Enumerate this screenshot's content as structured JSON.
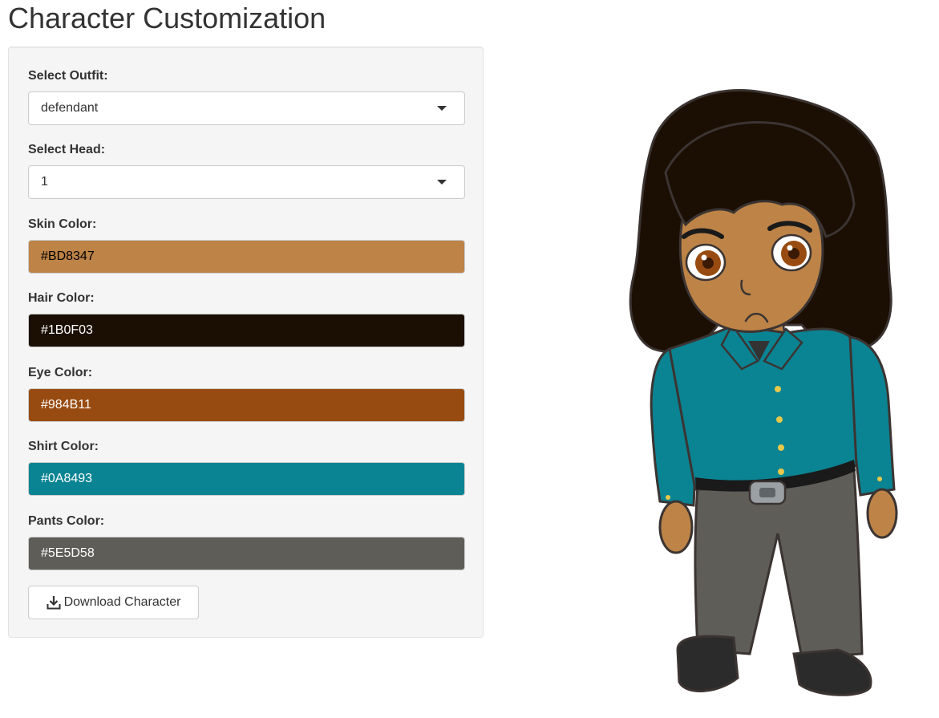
{
  "page": {
    "title": "Character Customization"
  },
  "controls": {
    "outfit": {
      "label": "Select Outfit:",
      "value": "defendant"
    },
    "head": {
      "label": "Select Head:",
      "value": "1"
    },
    "skin": {
      "label": "Skin Color:",
      "value": "#BD8347",
      "color": "#BD8347",
      "text_color": "#000000"
    },
    "hair": {
      "label": "Hair Color:",
      "value": "#1B0F03",
      "color": "#1B0F03",
      "text_color": "#ffffff"
    },
    "eye": {
      "label": "Eye Color:",
      "value": "#984B11",
      "color": "#984B11",
      "text_color": "#ffffff"
    },
    "shirt": {
      "label": "Shirt Color:",
      "value": "#0A8493",
      "color": "#0A8493",
      "text_color": "#ffffff"
    },
    "pants": {
      "label": "Pants Color:",
      "value": "#5E5D58",
      "color": "#5E5D58",
      "text_color": "#ffffff"
    },
    "download": {
      "label": "Download Character",
      "icon": "download-icon"
    }
  },
  "preview": {
    "character": "character-illustration"
  }
}
